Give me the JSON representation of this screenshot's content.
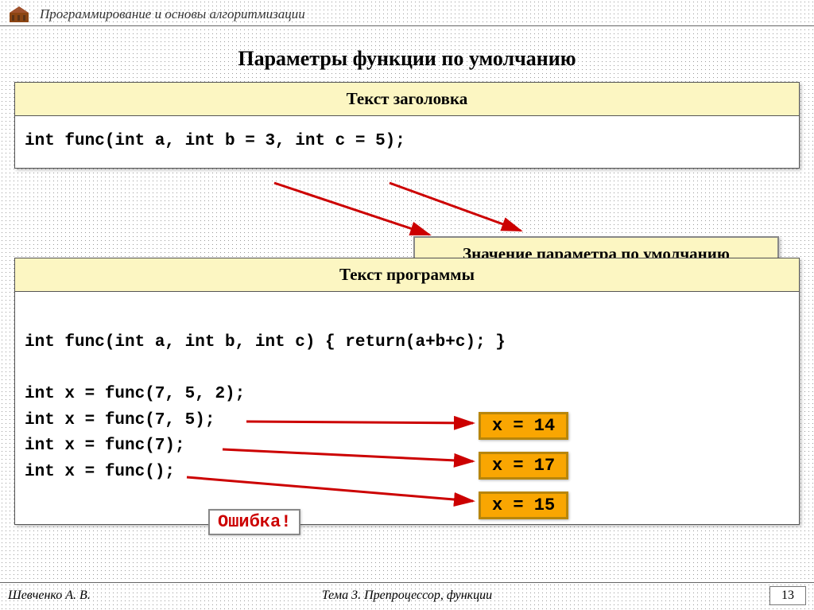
{
  "header": {
    "course": "Программирование и основы алгоритмизации"
  },
  "title": "Параметры функции по умолчанию",
  "panel1": {
    "heading": "Текст заголовка",
    "code": "int func(int a, int b = 3, int c = 5);"
  },
  "callout1": "Значение параметра по умолчанию",
  "panel2": {
    "heading": "Текст программы",
    "line1": "int func(int a, int b, int c) { return(a+b+c); }",
    "line2": "int x = func(7, 5, 2);",
    "line3": "int x = func(7, 5);",
    "line4": "int x = func(7);",
    "line5": "int x = func();"
  },
  "results": {
    "r1": "x = 14",
    "r2": "x = 17",
    "r3": "x = 15"
  },
  "error": "Ошибка!",
  "footer": {
    "author": "Шевченко А. В.",
    "topic": "Тема 3. Препроцессор, функции",
    "page": "13"
  }
}
